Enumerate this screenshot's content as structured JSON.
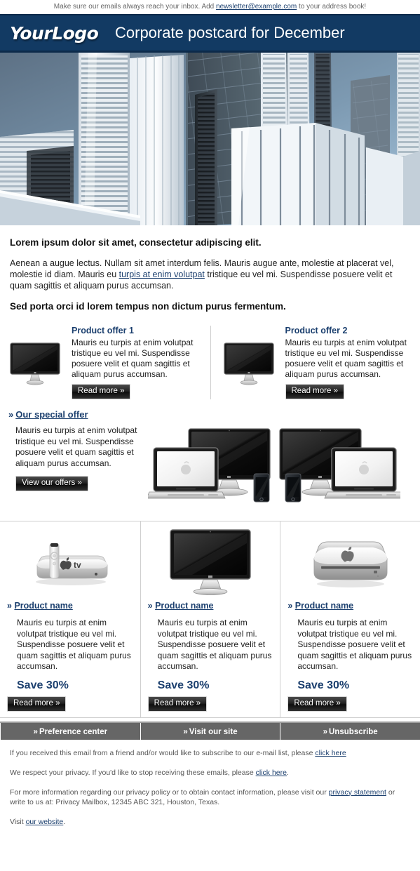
{
  "preheader": {
    "before": "Make sure our emails always reach your inbox. Add ",
    "email": "newsletter@example.com",
    "after": " to your address book!"
  },
  "header": {
    "logo": "YourLogo",
    "title": "Corporate postcard for December"
  },
  "hero": {
    "alt": "city-skyscrapers-photo"
  },
  "intro": {
    "heading": "Lorem ipsum dolor sit amet, consectetur adipiscing elit.",
    "body_before": "Aenean a augue lectus. Nullam sit amet interdum felis. Mauris augue ante, molestie at placerat vel, molestie id diam. Mauris eu ",
    "body_link": "turpis at enim volutpat",
    "body_after": " tristique eu vel mi. Suspendisse posuere velit et quam sagittis et aliquam purus accumsan.",
    "subheading": "Sed porta orci id lorem tempus non dictum purus fermentum."
  },
  "offers": [
    {
      "title": "Product offer 1",
      "text": "Mauris eu turpis at enim volutpat tristique eu vel mi. Suspendisse posuere velit et quam sagittis et aliquam purus accumsan.",
      "button": "Read more »",
      "image": "imac-display-icon"
    },
    {
      "title": "Product offer 2",
      "text": "Mauris eu turpis at enim volutpat tristique eu vel mi. Suspendisse posuere velit et quam sagittis et aliquam purus accumsan.",
      "button": "Read more »",
      "image": "imac-display-icon"
    }
  ],
  "special": {
    "chevron": "»",
    "heading": "Our special offer",
    "text": "Mauris eu turpis at enim volutpat tristique eu vel mi. Suspendisse posuere velit et quam sagittis et aliquam purus accumsan.",
    "button": "View our offers »",
    "image": "devices-lineup-photo"
  },
  "products": [
    {
      "chevron": "»",
      "name": "Product name",
      "text": "Mauris eu turpis at enim volutpat tristique eu vel mi. Suspendisse posuere velit et quam sagittis et aliquam purus accumsan.",
      "save": "Save 30%",
      "button": "Read more »",
      "image": "apple-tv-icon"
    },
    {
      "chevron": "»",
      "name": "Product name",
      "text": "Mauris eu turpis at enim volutpat tristique eu vel mi. Suspendisse posuere velit et quam sagittis et aliquam purus accumsan.",
      "save": "Save 30%",
      "button": "Read more »",
      "image": "cinema-display-icon"
    },
    {
      "chevron": "»",
      "name": "Product name",
      "text": "Mauris eu turpis at enim volutpat tristique eu vel mi. Suspendisse posuere velit et quam sagittis et aliquam purus accumsan.",
      "save": "Save 30%",
      "button": "Read more »",
      "image": "mac-mini-icon"
    }
  ],
  "footer_nav": [
    {
      "chevron": "»",
      "label": "Preference center"
    },
    {
      "chevron": "»",
      "label": "Visit our site"
    },
    {
      "chevron": "»",
      "label": "Unsubscribe"
    }
  ],
  "legal": {
    "line1_before": "If you received this email from a friend and/or would like to subscribe to our e-mail list, please ",
    "line1_link": "click here",
    "line1_after": "",
    "line2_before": "We respect your privacy. If you'd like to stop receiving these emails, please ",
    "line2_link": "click here",
    "line2_after": ".",
    "line3_before": "For more information regarding our privacy policy or to obtain contact information, please visit our ",
    "line3_link": "privacy statement",
    "line3_after": " or write to us at: Privacy Mailbox, 12345 ABC 321, Houston, Texas.",
    "line4_before": "Visit ",
    "line4_link": "our website",
    "line4_after": "."
  },
  "colors": {
    "header_bg": "#123a63",
    "accent": "#1b3f6e",
    "footer_bar": "#666666",
    "divider": "#cfcfcf"
  }
}
